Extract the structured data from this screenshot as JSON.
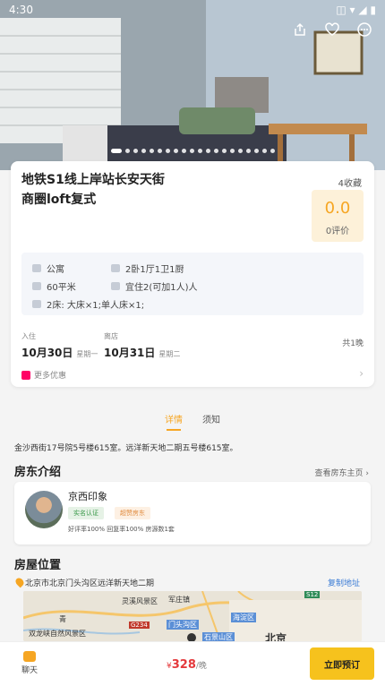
{
  "status_bar": {
    "time": "4:30"
  },
  "listing": {
    "title_line1": "地铁S1线上岸站长安天街",
    "title_line2": "商圈loft复式",
    "favorites": "4收藏",
    "score": "0.0",
    "reviews": "0评价",
    "info": {
      "type": "公寓",
      "layout": "2卧1厅1卫1厨",
      "area": "60平米",
      "guests": "宜住2(可加1人)人",
      "beds": "2床: 大床×1;单人床×1;"
    },
    "checkin_label": "入住",
    "checkin_date": "10月30日",
    "checkin_weekday": "星期一",
    "checkout_label": "离店",
    "checkout_date": "10月31日",
    "checkout_weekday": "星期二",
    "nights": "共1晚",
    "more_offers": "更多优惠"
  },
  "tabs": [
    {
      "label": "详情",
      "active": true
    },
    {
      "label": "须知",
      "active": false
    }
  ],
  "address_line": "金沙西街17号院5号楼615室。远洋新天地二期五号楼615室。",
  "host_section": {
    "heading": "房东介绍",
    "see_link": "查看房东主页",
    "name": "京西印象",
    "badge_verified": "实名认证",
    "badge_super": "超赞房东",
    "stats": "好评率100%   回复率100%   房源数1套"
  },
  "location_section": {
    "heading": "房屋位置",
    "address": "北京市北京门头沟区远洋新天地二期",
    "copy_label": "复制地址",
    "map_labels": [
      "灵溪风景区",
      "军庄镇",
      "门头沟区",
      "海淀区",
      "双龙峡自然风景区",
      "石景山区",
      "北京",
      "G234",
      "S12",
      "青"
    ]
  },
  "bottom_bar": {
    "chat_label": "聊天",
    "price_symbol": "¥",
    "price": "328",
    "price_unit": "/晚",
    "book_label": "立即预订"
  },
  "colors": {
    "accent": "#f6a623",
    "book_button": "#f6c21d",
    "price": "#e4393c"
  }
}
